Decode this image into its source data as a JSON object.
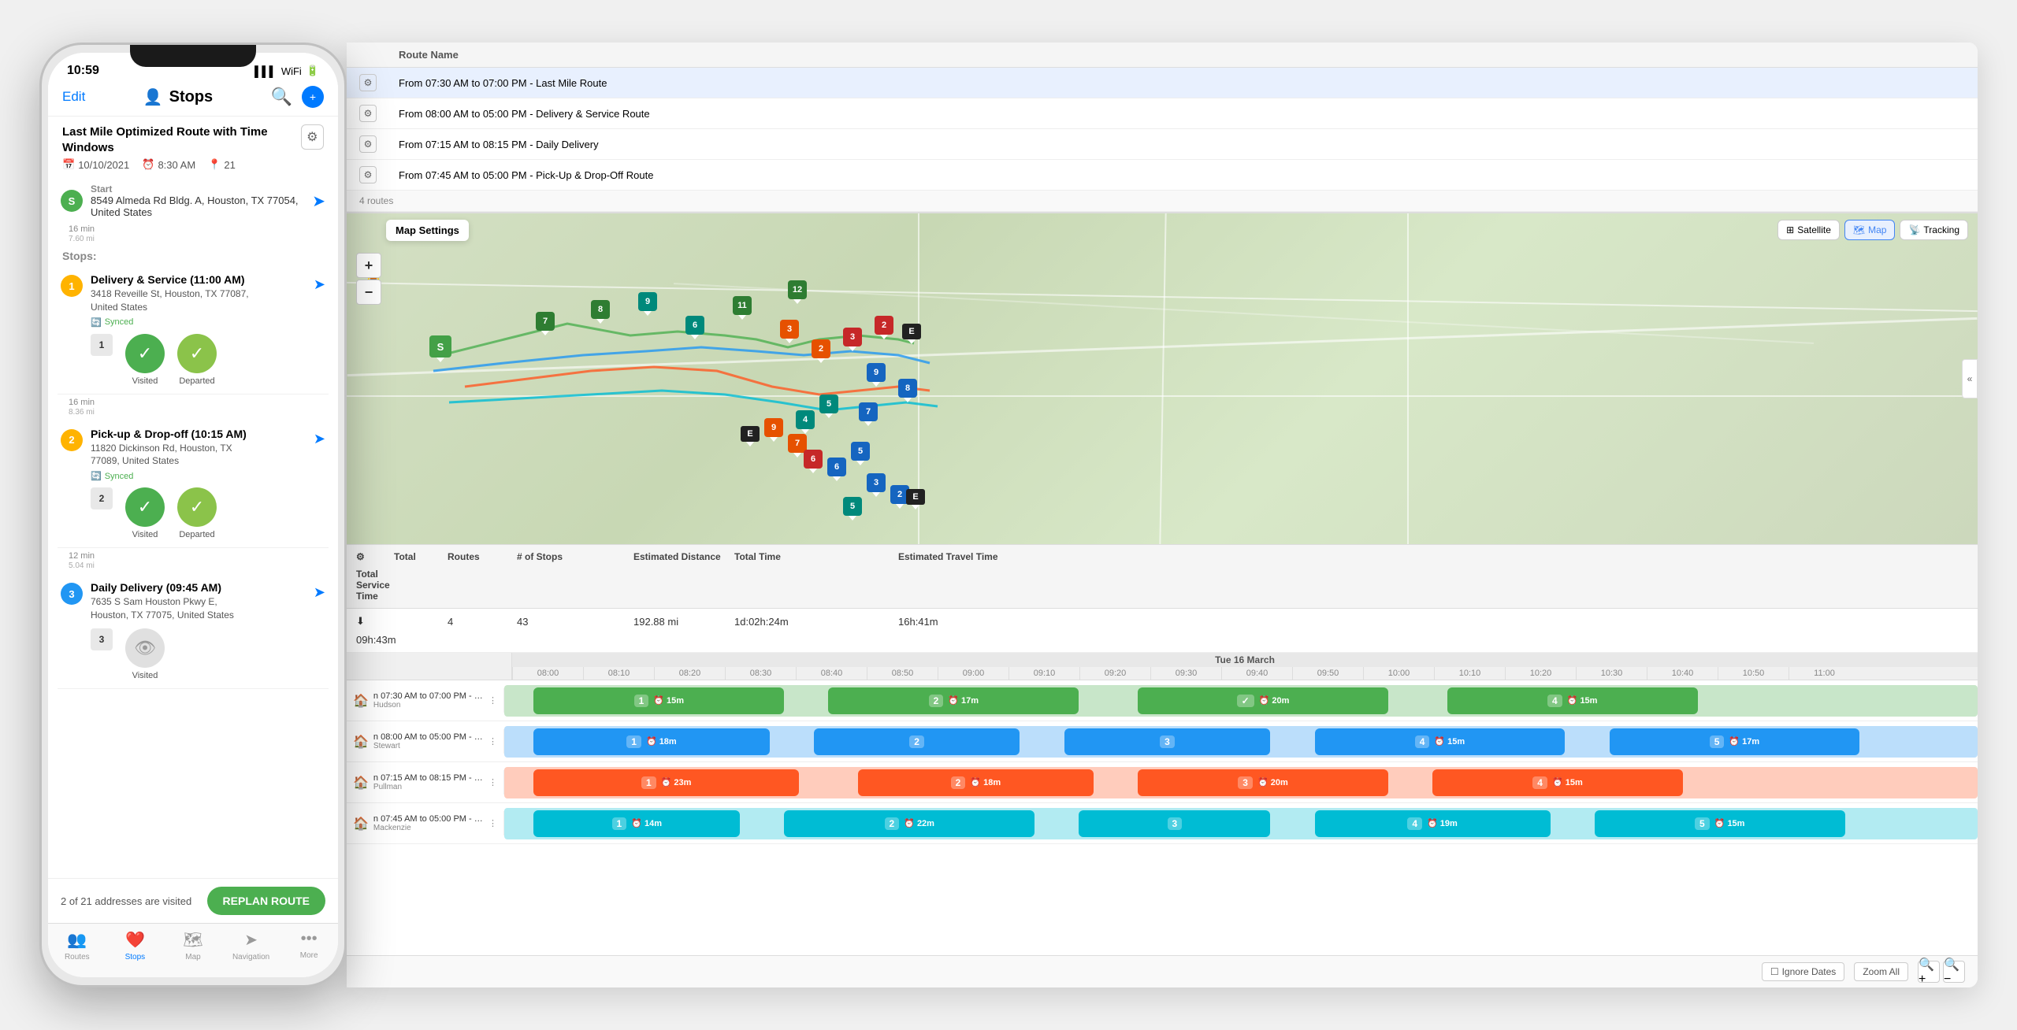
{
  "phone": {
    "status_time": "10:59",
    "header": {
      "edit": "Edit",
      "title": "Stops",
      "settings_gear": "⚙",
      "user_icon": "👤"
    },
    "route": {
      "title": "Last Mile Optimized Route with Time Windows",
      "date": "10/10/2021",
      "time": "8:30 AM",
      "stops_count": "21"
    },
    "start": {
      "label": "Start",
      "address": "8549 Almeda Rd Bldg. A, Houston, TX 77054, United States"
    },
    "stops_label": "Stops:",
    "stops": [
      {
        "number": "1",
        "color": "#FFB300",
        "name": "Delivery & Service (11:00 AM)",
        "address": "3418 Reveille St, Houston, TX 77087, United States",
        "synced": "Synced",
        "badge": "1",
        "visited_label": "Visited",
        "departed_label": "Departed"
      },
      {
        "number": "2",
        "color": "#FFB300",
        "name": "Pick-up & Drop-off (10:15 AM)",
        "address": "11820 Dickinson Rd, Houston, TX 77089, United States",
        "synced": "Synced",
        "badge": "2",
        "visited_label": "Visited",
        "departed_label": "Departed"
      },
      {
        "number": "3",
        "color": "#2196F3",
        "name": "Daily Delivery (09:45 AM)",
        "address": "7635 S Sam Houston Pkwy E, Houston, TX 77075, United States",
        "synced": "",
        "badge": "3",
        "visited_label": "Visited",
        "departed_label": ""
      }
    ],
    "replan_text": "2 of 21 addresses are visited",
    "replan_btn": "REPLAN ROUTE",
    "tabs": [
      {
        "icon": "👤",
        "label": "Routes"
      },
      {
        "icon": "📍",
        "label": "Stops",
        "active": true
      },
      {
        "icon": "🗺",
        "label": "Map"
      },
      {
        "icon": "➤",
        "label": "Navigation"
      },
      {
        "icon": "•••",
        "label": "More"
      }
    ]
  },
  "desktop": {
    "routes_table": {
      "header": "Route Name",
      "routes": [
        {
          "id": 1,
          "name": "From 07:30 AM to 07:00 PM - Last Mile Route",
          "selected": true
        },
        {
          "id": 2,
          "name": "From 08:00 AM to 05:00 PM - Delivery & Service Route"
        },
        {
          "id": 3,
          "name": "From 07:15 AM to 08:15 PM - Daily Delivery"
        },
        {
          "id": 4,
          "name": "From 07:45 AM to 05:00 PM - Pick-Up & Drop-Off Route"
        }
      ],
      "routes_count": "4 routes"
    },
    "map": {
      "settings_label": "Map Settings",
      "satellite_btn": "Satellite",
      "map_btn": "Map",
      "tracking_btn": "Tracking"
    },
    "stats": {
      "headers": [
        "",
        "Total",
        "Routes",
        "# of Stops",
        "Estimated Distance",
        "Total Time",
        "Estimated Travel Time",
        "Total Service Time"
      ],
      "row": {
        "routes": "4",
        "stops": "43",
        "est_distance": "192.88 mi",
        "total_time": "1d:02h:24m",
        "est_travel": "16h:41m",
        "service_time": "09h:43m"
      }
    },
    "timeline": {
      "date": "Tue 16 March",
      "times": [
        "08:00",
        "08:10",
        "08:20",
        "08:30",
        "08:40",
        "08:50",
        "09:00",
        "09:10",
        "09:20",
        "09:30",
        "09:40",
        "09:50",
        "10:00",
        "10:10",
        "10:20",
        "10:30",
        "10:40",
        "10:50",
        "11:00"
      ],
      "rows": [
        {
          "name": "n 07:30 AM to 07:00 PM - Last Mile ...",
          "driver": "Hudson",
          "color": "#4CAF50",
          "bars": [
            {
              "start_pct": 2,
              "width_pct": 17,
              "stop": "1",
              "time": "15m"
            },
            {
              "start_pct": 22,
              "width_pct": 17,
              "stop": "2",
              "time": "17m"
            },
            {
              "start_pct": 43,
              "width_pct": 18,
              "stop": "✓",
              "time": "20m"
            },
            {
              "start_pct": 66,
              "width_pct": 17,
              "stop": "4",
              "time": "15m"
            }
          ]
        },
        {
          "name": "n 08:00 AM to 05:00 PM - Delivery ...",
          "driver": "Stewart",
          "color": "#2196F3",
          "bars": [
            {
              "start_pct": 2,
              "width_pct": 17,
              "stop": "1",
              "time": "18m"
            },
            {
              "start_pct": 22,
              "width_pct": 16,
              "stop": "2",
              "time": ""
            },
            {
              "start_pct": 41,
              "width_pct": 15,
              "stop": "3",
              "time": ""
            },
            {
              "start_pct": 59,
              "width_pct": 17,
              "stop": "4",
              "time": "15m"
            },
            {
              "start_pct": 79,
              "width_pct": 17,
              "stop": "5",
              "time": "17m"
            }
          ]
        },
        {
          "name": "n 07:15 AM to 08:15 PM - Daily Deli...",
          "driver": "Pullman",
          "color": "#FF5722",
          "bars": [
            {
              "start_pct": 2,
              "width_pct": 18,
              "stop": "1",
              "time": "23m"
            },
            {
              "start_pct": 24,
              "width_pct": 17,
              "stop": "2",
              "time": "18m"
            },
            {
              "start_pct": 45,
              "width_pct": 18,
              "stop": "3",
              "time": "20m"
            },
            {
              "start_pct": 67,
              "width_pct": 17,
              "stop": "4",
              "time": "15m"
            }
          ]
        },
        {
          "name": "n 07:45 AM to 05:00 PM - Pick-Up &...",
          "driver": "Mackenzie",
          "color": "#00BCD4",
          "bars": [
            {
              "start_pct": 2,
              "width_pct": 15,
              "stop": "1",
              "time": "14m"
            },
            {
              "start_pct": 20,
              "width_pct": 17,
              "stop": "2",
              "time": "22m"
            },
            {
              "start_pct": 40,
              "width_pct": 14,
              "stop": "3",
              "time": ""
            },
            {
              "start_pct": 57,
              "width_pct": 16,
              "stop": "4",
              "time": "19m"
            },
            {
              "start_pct": 77,
              "width_pct": 17,
              "stop": "5",
              "time": "15m"
            }
          ]
        }
      ]
    },
    "bottom_bar": {
      "ignore_dates": "Ignore Dates",
      "zoom_all": "Zoom All"
    }
  }
}
